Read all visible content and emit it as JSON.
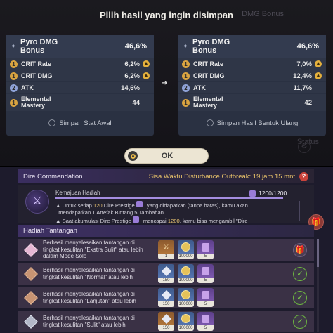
{
  "header": {
    "title": "Pilih hasil yang ingin disimpan",
    "ghost_text": "DMG Bonus",
    "ghost_text2": "Status"
  },
  "left_panel": {
    "main": {
      "name_line1": "Pyro DMG",
      "name_line2": "Bonus",
      "value": "46,6%"
    },
    "subs": [
      {
        "badge": "1",
        "name": "CRIT Rate",
        "value": "6,2%",
        "up": true
      },
      {
        "badge": "1",
        "name": "CRIT DMG",
        "value": "6,2%",
        "up": true
      },
      {
        "badge": "2",
        "name": "ATK",
        "value": "14,6%",
        "up": false
      },
      {
        "badge": "1",
        "name_line1": "Elemental",
        "name_line2": "Mastery",
        "value": "44",
        "up": false
      }
    ],
    "save_label": "Simpan Stat Awal"
  },
  "right_panel": {
    "main": {
      "name_line1": "Pyro DMG",
      "name_line2": "Bonus",
      "value": "46,6%"
    },
    "subs": [
      {
        "badge": "1",
        "name": "CRIT Rate",
        "value": "7,0%",
        "up": true
      },
      {
        "badge": "1",
        "name": "CRIT DMG",
        "value": "12,4%",
        "up": true
      },
      {
        "badge": "2",
        "name": "ATK",
        "value": "11,7%",
        "up": false
      },
      {
        "badge": "1",
        "name_line1": "Elemental",
        "name_line2": "Mastery",
        "value": "42",
        "up": false
      }
    ],
    "save_label": "Simpan Hasil Bentuk Ulang"
  },
  "ok_button": {
    "label": "OK"
  },
  "dire": {
    "title": "Dire Commendation",
    "timer": "Sisa Waktu Disturbance Outbreak: 19 jam 15 mnt",
    "progress_label": "Kemajuan Hadiah",
    "progress_count": "1200/1200",
    "progress_fraction": 1.0,
    "line1_a": "Untuk setiap",
    "line1_num": "120",
    "line1_b": "Dire Prestige",
    "line1_c": "yang didapatkan (tanpa batas), kamu akan",
    "line2": "mendapatkan 1 Artefak Bintang 5 Tambahan.",
    "line3_a": "Saat akumulasi Dire Prestige",
    "line3_b": "mencapai",
    "line3_num": "1200",
    "line3_c": ", kamu bisa mengambil \"Dire"
  },
  "challenges": {
    "title": "Hadiah Tantangan",
    "rows": [
      {
        "line1": "Berhasil menyelesaikan tantangan di",
        "line2": "tingkat kesulitan \"Ekstra Sulit\" atau lebih",
        "line3": "dalam Mode Solo",
        "rewards": [
          {
            "color": "orange",
            "icon": "sword-icon",
            "qty": "1"
          },
          {
            "color": "blue",
            "icon": "mora-icon",
            "qty": "100000"
          },
          {
            "color": "purple",
            "icon": "book-icon",
            "qty": "5"
          }
        ],
        "status": "gift"
      },
      {
        "line1": "Berhasil menyelesaikan tantangan di",
        "line2": "tingkat kesulitan \"Normal\" atau lebih",
        "line3": "",
        "rewards": [
          {
            "color": "blue",
            "icon": "primogem-icon",
            "qty": "150"
          },
          {
            "color": "blue",
            "icon": "mora-icon",
            "qty": "100000"
          },
          {
            "color": "purple",
            "icon": "book-icon",
            "qty": "5"
          }
        ],
        "status": "claimed"
      },
      {
        "line1": "Berhasil menyelesaikan tantangan di",
        "line2": "tingkat kesulitan \"Lanjutan\" atau lebih",
        "line3": "",
        "rewards": [
          {
            "color": "blue",
            "icon": "primogem-icon",
            "qty": "150"
          },
          {
            "color": "blue",
            "icon": "mora-icon",
            "qty": "100000"
          },
          {
            "color": "purple",
            "icon": "book-icon",
            "qty": "5"
          }
        ],
        "status": "claimed"
      },
      {
        "line1": "Berhasil menyelesaikan tantangan di",
        "line2": "tingkat kesulitan \"Sulit\" atau lebih",
        "line3": "",
        "rewards": [
          {
            "color": "orange",
            "icon": "primogem-icon",
            "qty": "150"
          },
          {
            "color": "blue",
            "icon": "mora-icon",
            "qty": "100000"
          },
          {
            "color": "purple",
            "icon": "book-icon",
            "qty": "5"
          }
        ],
        "status": "claimed"
      }
    ]
  },
  "colors": {
    "accent_gold": "#e8c372",
    "check_green": "#7fd24b",
    "timer": "#e9c36a"
  }
}
